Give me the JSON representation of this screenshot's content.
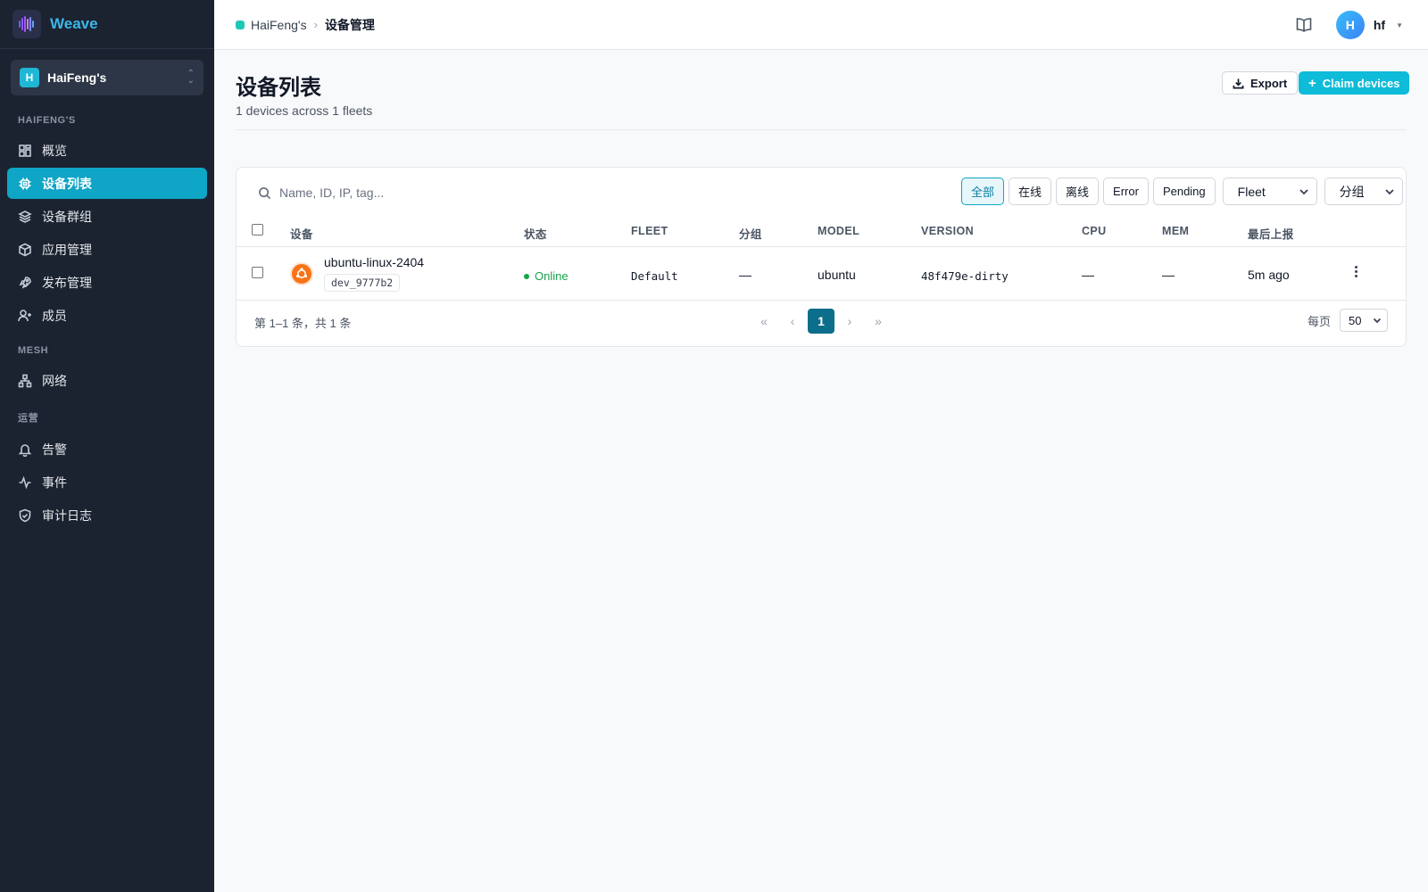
{
  "app": {
    "name": "Weave"
  },
  "org": {
    "initial": "H",
    "name": "HaiFeng's"
  },
  "sidebar": {
    "sections": [
      {
        "title": "HAIFENG'S"
      },
      {
        "title": "MESH"
      },
      {
        "title": "运营"
      }
    ],
    "items": [
      {
        "label": "概览",
        "icon": "dashboard-icon"
      },
      {
        "label": "设备列表",
        "icon": "chip-icon",
        "active": true
      },
      {
        "label": "设备群组",
        "icon": "layers-icon"
      },
      {
        "label": "应用管理",
        "icon": "package-icon"
      },
      {
        "label": "发布管理",
        "icon": "rocket-icon"
      },
      {
        "label": "成员",
        "icon": "user-plus-icon"
      },
      {
        "label": "网络",
        "icon": "network-icon"
      },
      {
        "label": "告警",
        "icon": "bell-icon"
      },
      {
        "label": "事件",
        "icon": "activity-icon"
      },
      {
        "label": "审计日志",
        "icon": "shield-icon"
      }
    ]
  },
  "breadcrumb": {
    "org": "HaiFeng's",
    "current": "设备管理"
  },
  "user": {
    "initial": "H",
    "name": "hf"
  },
  "page": {
    "title": "设备列表",
    "subtitle": "1 devices across 1 fleets",
    "export_label": "Export",
    "claim_label": "Claim devices"
  },
  "search": {
    "placeholder": "Name, ID, IP, tag..."
  },
  "filters": {
    "chips": [
      "全部",
      "在线",
      "离线",
      "Error",
      "Pending"
    ],
    "active": "全部",
    "fleet_select": "Fleet",
    "group_select": "分组"
  },
  "table": {
    "columns": [
      "设备",
      "状态",
      "FLEET",
      "分组",
      "MODEL",
      "VERSION",
      "CPU",
      "MEM",
      "最后上报"
    ],
    "rows": [
      {
        "name": "ubuntu-linux-2404",
        "id": "dev_9777b2",
        "status": "Online",
        "fleet": "Default",
        "group": "—",
        "model": "ubuntu",
        "version": "48f479e-dirty",
        "cpu": "—",
        "mem": "—",
        "last_seen": "5m ago"
      }
    ]
  },
  "pagination": {
    "summary": "第 1–1 条，共 1 条",
    "first": "«",
    "prev": "‹",
    "current_page": "1",
    "next": "›",
    "last": "»",
    "per_page_label": "每页",
    "per_page": "50"
  },
  "colors": {
    "accent": "#0ea5c6",
    "sidebar_bg": "#1b2330",
    "online": "#16a34a",
    "brand": "#3fb6e8"
  }
}
